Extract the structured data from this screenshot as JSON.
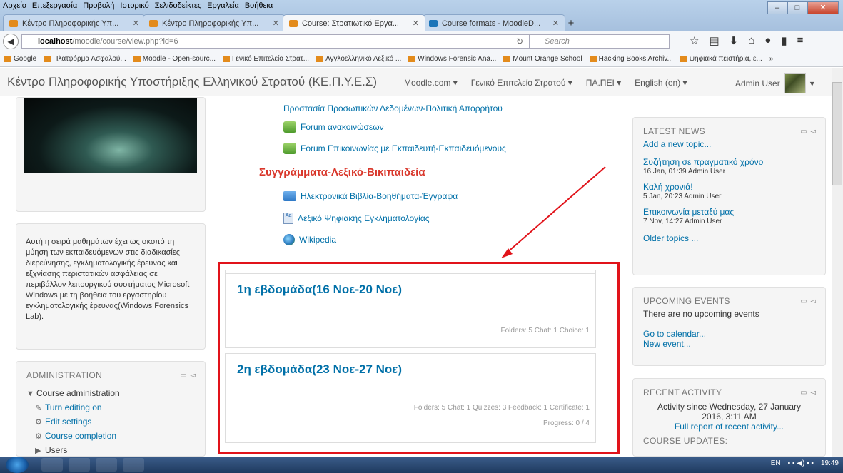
{
  "browser": {
    "menu": [
      "Αρχείο",
      "Επεξεργασία",
      "Προβολή",
      "Ιστορικό",
      "Σελιδοδείκτες",
      "Εργαλεία",
      "Βοήθεια"
    ],
    "tabs": [
      {
        "title": "Κέντρο Πληροφορικής Υπ...",
        "active": false
      },
      {
        "title": "Κέντρο Πληροφορικής Υπ...",
        "active": false
      },
      {
        "title": "Course: Στρατιωτικό Εργα...",
        "active": true
      },
      {
        "title": "Course formats - MoodleD...",
        "active": false
      }
    ],
    "newtab": "+",
    "url_host": "localhost",
    "url_path": "/moodle/course/view.php?id=6",
    "search_placeholder": "Search",
    "bookmarks": [
      "Google",
      "Πλατφόρμα Ασφαλού...",
      "Moodle - Open-sourc...",
      "Γενικό Επιτελείο Στρατ...",
      "Αγγλοελληνικό Λεξικό ...",
      "Windows Forensic Ana...",
      "Mount Orange School",
      "Hacking Books Archiv...",
      "ψηφιακά πειστήρια, ε..."
    ],
    "bookmarks_more": "»"
  },
  "site": {
    "name": "Κέντρο Πληροφορικής Υποστήριξης Ελληνικού Στρατού (ΚΕ.Π.Υ.Ε.Σ)",
    "nav": [
      "Moodle.com ▾",
      "Γενικό Επιτελείο Στρατού ▾",
      "ΠΑ.ΠΕΙ ▾",
      "English (en) ▾"
    ],
    "user": "Admin User"
  },
  "left": {
    "description": "Αυτή η σειρά μαθημάτων έχει ως σκοπό τη μύηση των εκπαιδευόμενων στις διαδικασίες διερεύνησης, εγκληματολογικής έρευνας και εξχνίασης περιστατικών ασφάλειας σε περιβάλλον λειτουργικού συστήματος Microsoft Windows με τη βοήθεια του εργαστηρίου εγκληματολογικής έρευνας(Windows Forensics Lab).",
    "admin_title": "ADMINISTRATION",
    "admin_items": [
      "Course administration",
      "Turn editing on",
      "Edit settings",
      "Course completion",
      "Users"
    ]
  },
  "center": {
    "top_link": "Προστασία Προσωπικών Δεδομένων-Πολιτική Απορρήτου",
    "forum1": "Forum ανακοινώσεων",
    "forum2": "Forum Επικοινωνίας με Εκπαιδευτή-Εκπαιδευόμενους",
    "section3_title": "Συγγράμματα-Λεξικό-Βικιπαιδεία",
    "ebooks": "Ηλεκτρονικά Βιβλία-Βοηθήματα-Έγγραφα",
    "glossary": "Λεξικό Ψηφιακής Εγκληματολογίας",
    "wiki": "Wikipedia",
    "weeks": [
      {
        "name": "1η εβδομάδα(16 Νοε-20 Νοε)",
        "summary": "Folders: 5  Chat: 1  Choice: 1"
      },
      {
        "name": "2η εβδομάδα(23 Νοε-27 Νοε)",
        "summary": "Folders: 5  Chat: 1  Quizzes: 3  Feedback: 1  Certificate: 1",
        "progress": "Progress: 0 / 4"
      }
    ]
  },
  "right": {
    "news_title": "LATEST NEWS",
    "add_topic": "Add a new topic...",
    "news": [
      {
        "title": "Συζήτηση σε πραγματικό χρόνο",
        "meta": "16 Jan, 01:39  Admin User"
      },
      {
        "title": "Καλή χρονιά!",
        "meta": "5 Jan, 20:23  Admin User"
      },
      {
        "title": "Επικοινωνία μεταξύ μας",
        "meta": "7 Nov, 14:27  Admin User"
      }
    ],
    "older": "Older topics ...",
    "events_title": "UPCOMING EVENTS",
    "no_events": "There are no upcoming events",
    "calendar": "Go to calendar...",
    "new_event": "New event...",
    "recent_title": "RECENT ACTIVITY",
    "recent_since": "Activity since Wednesday, 27 January 2016, 3:11 AM",
    "full_report": "Full report of recent activity...",
    "course_updates": "COURSE UPDATES:"
  },
  "taskbar": {
    "lang": "EN",
    "time": "19:49"
  },
  "colors": {
    "accent": "#0070a8",
    "section_red": "#d9372b",
    "highlight_box": "#e1131a"
  }
}
